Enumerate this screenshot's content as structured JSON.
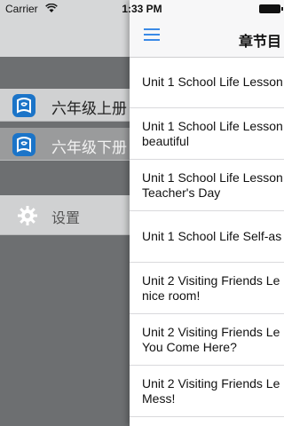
{
  "status_bar": {
    "carrier": "Carrier",
    "time": "1:33 PM"
  },
  "menu": {
    "items": [
      {
        "label": "六年级上册",
        "icon": "book-app-icon"
      },
      {
        "label": "六年级下册",
        "icon": "book-app-icon"
      }
    ],
    "settings": {
      "label": "设置",
      "icon": "gear-icon"
    }
  },
  "panel": {
    "title": "章节目",
    "rows": [
      {
        "line1": "Unit 1 School Life Lesson",
        "line2": ""
      },
      {
        "line1": "Unit 1 School Life Lesson",
        "line2": "beautiful"
      },
      {
        "line1": "Unit 1 School Life Lesson",
        "line2": "Teacher's Day"
      },
      {
        "line1": "Unit 1 School Life Self-as",
        "line2": ""
      },
      {
        "line1": "Unit 2 Visiting Friends Le",
        "line2": "nice room!"
      },
      {
        "line1": "Unit 2 Visiting Friends Le",
        "line2": "You Come Here?"
      },
      {
        "line1": "Unit 2 Visiting Friends Le",
        "line2": "Mess!"
      }
    ]
  },
  "colors": {
    "accent": "#3b8ae6",
    "app_icon": "#1b74c8"
  }
}
